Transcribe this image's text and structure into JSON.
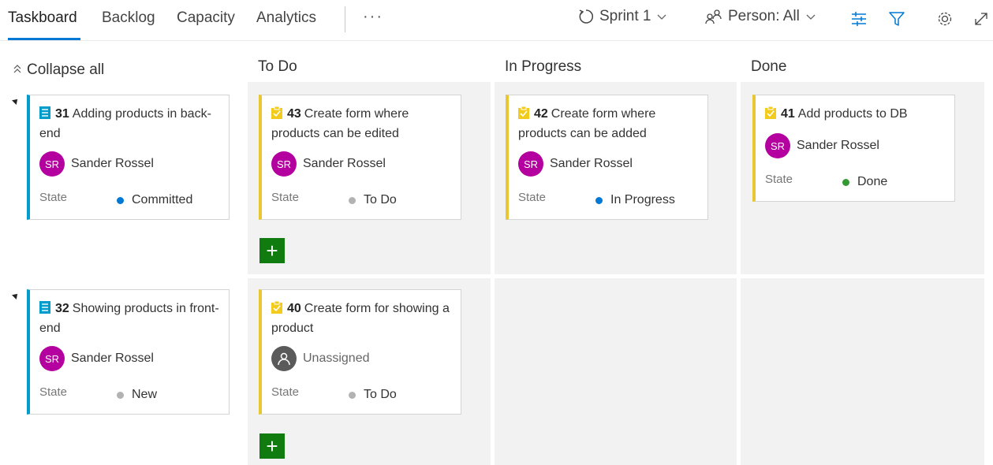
{
  "tabs": [
    {
      "label": "Taskboard",
      "active": true
    },
    {
      "label": "Backlog"
    },
    {
      "label": "Capacity"
    },
    {
      "label": "Analytics"
    }
  ],
  "more_label": "···",
  "toolbar": {
    "sprint_label": "Sprint 1",
    "person_label": "Person: All",
    "icons": [
      "sprint-icon",
      "person-icon",
      "settings-sliders-icon",
      "filter-icon",
      "gear-icon",
      "expand-icon"
    ]
  },
  "board": {
    "collapse_label": "Collapse all",
    "columns": [
      "To Do",
      "In Progress",
      "Done"
    ],
    "state_label": "State",
    "colors": {
      "pbi_bar": "#009ccc",
      "task_bar": "#e8c733",
      "committed": "#0078d4",
      "todo": "#b2b2b2",
      "in_progress": "#0078d4",
      "done": "#339933",
      "new": "#b2b2b2",
      "avatar": "#b4009e",
      "add": "#107c10"
    },
    "rows": [
      {
        "pbi": {
          "id": "31",
          "title": "Adding products in back-end",
          "assignee_initials": "SR",
          "assignee": "Sander Rossel",
          "state": "Committed"
        },
        "todo": [
          {
            "id": "43",
            "title": "Create form where products can be edited",
            "assignee_initials": "SR",
            "assignee": "Sander Rossel",
            "state": "To Do"
          }
        ],
        "in_progress": [
          {
            "id": "42",
            "title": "Create form where products can be added",
            "assignee_initials": "SR",
            "assignee": "Sander Rossel",
            "state": "In Progress"
          }
        ],
        "done": [
          {
            "id": "41",
            "title": "Add products to DB",
            "assignee_initials": "SR",
            "assignee": "Sander Rossel",
            "state": "Done"
          }
        ]
      },
      {
        "pbi": {
          "id": "32",
          "title": "Showing products in front-end",
          "assignee_initials": "SR",
          "assignee": "Sander Rossel",
          "state": "New"
        },
        "todo": [
          {
            "id": "40",
            "title": "Create form for showing a product",
            "assignee": "Unassigned",
            "state": "To Do"
          }
        ]
      }
    ]
  }
}
